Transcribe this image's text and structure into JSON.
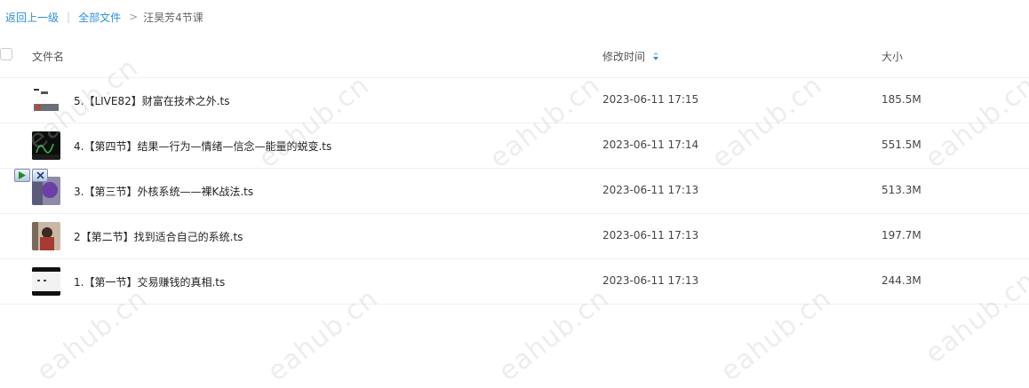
{
  "breadcrumb": {
    "back": "返回上一级",
    "separator": "|",
    "all_files": "全部文件",
    "arrow": ">",
    "current": "汪昊芳4节课"
  },
  "header": {
    "name": "文件名",
    "time": "修改时间",
    "size": "大小"
  },
  "files": [
    {
      "name": "5.【LIVE82】财富在技术之外.ts",
      "time": "2023-06-11 17:15",
      "size": "185.5M"
    },
    {
      "name": "4.【第四节】结果—行为—情绪—信念—能量的蜕变.ts",
      "time": "2023-06-11 17:14",
      "size": "551.5M"
    },
    {
      "name": "3.【第三节】外核系统——裸K战法.ts",
      "time": "2023-06-11 17:13",
      "size": "513.3M"
    },
    {
      "name": "2【第二节】找到适合自己的系统.ts",
      "time": "2023-06-11 17:13",
      "size": "197.7M"
    },
    {
      "name": "1.【第一节】交易赚钱的真相.ts",
      "time": "2023-06-11 17:13",
      "size": "244.3M"
    }
  ],
  "watermark": "eahub.cn",
  "colors": {
    "link": "#2f8fd8",
    "sort": "#2f8fd8"
  }
}
